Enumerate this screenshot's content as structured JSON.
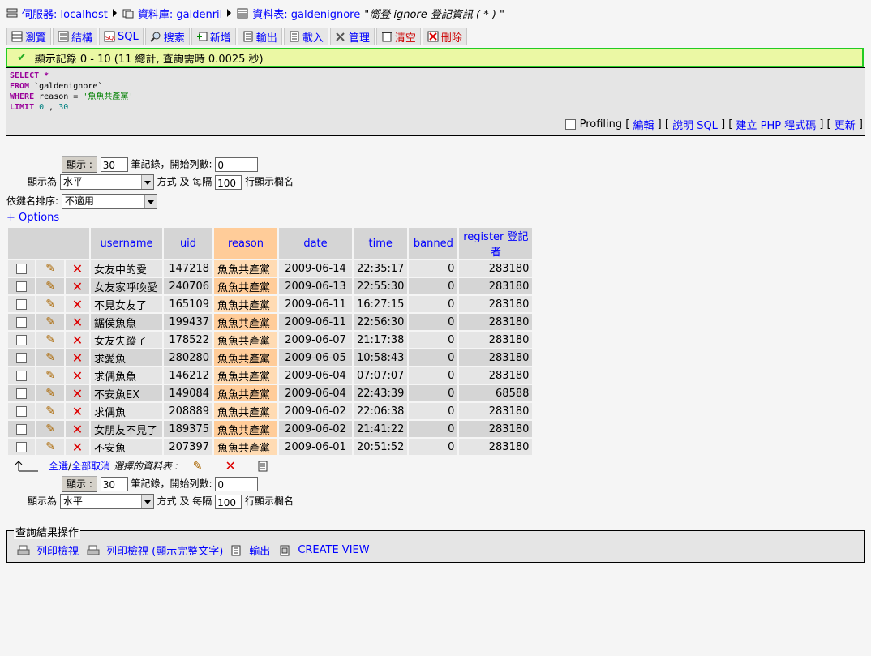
{
  "breadcrumb": {
    "server_label": "伺服器: localhost",
    "db_label": "資料庫: galdenril",
    "table_label": "資料表: galdenignore",
    "table_comment": "\"嚮登 ignore 登記資訊 ( * ) \""
  },
  "tabs": [
    {
      "label": "瀏覽"
    },
    {
      "label": "結構"
    },
    {
      "label": "SQL"
    },
    {
      "label": "搜索"
    },
    {
      "label": "新增"
    },
    {
      "label": "輸出"
    },
    {
      "label": "載入"
    },
    {
      "label": "管理"
    },
    {
      "label": "清空"
    },
    {
      "label": "刪除"
    }
  ],
  "status": {
    "message": "顯示記錄 0 - 10 (11 總計, 查詢需時 0.0025 秒)"
  },
  "sql": {
    "line1_kw": "SELECT",
    "line1_rest": " *",
    "line2_kw": "FROM",
    "line2_rest": " `galdenignore`",
    "line3_kw": "WHERE",
    "line3_mid": " reason = ",
    "line3_str": "'魚魚共產黨'",
    "line4_kw": "LIMIT",
    "line4_n1": " 0",
    "line4_comma": " , ",
    "line4_n2": "30"
  },
  "sql_footer": {
    "profiling": "Profiling",
    "edit": "編輯",
    "explain": "說明 SQL",
    "php": "建立 PHP 程式碼",
    "refresh": "更新"
  },
  "nav": {
    "show_button": "顯示 :",
    "rows_value": "30",
    "rows_suffix": "筆記錄，開始列數:",
    "start_value": "0",
    "mode_prefix": "顯示為",
    "mode_value": "水平",
    "mode_suffix": "方式 及 每隔",
    "repeat_value": "100",
    "repeat_suffix": "行顯示欄名",
    "sort_label": "依鍵名排序:",
    "sort_value": "不適用",
    "options": "+ Options"
  },
  "table": {
    "headers": [
      "username",
      "uid",
      "reason",
      "date",
      "time",
      "banned",
      "register 登記者"
    ],
    "rows": [
      [
        "女友中的愛",
        "147218",
        "魚魚共產黨",
        "2009-06-14",
        "22:35:17",
        "0",
        "283180"
      ],
      [
        "女友家呼喚愛",
        "240706",
        "魚魚共產黨",
        "2009-06-13",
        "22:55:30",
        "0",
        "283180"
      ],
      [
        "不見女友了",
        "165109",
        "魚魚共產黨",
        "2009-06-11",
        "16:27:15",
        "0",
        "283180"
      ],
      [
        "鋸侯魚魚",
        "199437",
        "魚魚共產黨",
        "2009-06-11",
        "22:56:30",
        "0",
        "283180"
      ],
      [
        "女友失蹤了",
        "178522",
        "魚魚共產黨",
        "2009-06-07",
        "21:17:38",
        "0",
        "283180"
      ],
      [
        "求愛魚",
        "280280",
        "魚魚共產黨",
        "2009-06-05",
        "10:58:43",
        "0",
        "283180"
      ],
      [
        "求偶魚魚",
        "146212",
        "魚魚共產黨",
        "2009-06-04",
        "07:07:07",
        "0",
        "283180"
      ],
      [
        "不安魚EX",
        "149084",
        "魚魚共產黨",
        "2009-06-04",
        "22:43:39",
        "0",
        "68588"
      ],
      [
        "求偶魚",
        "208889",
        "魚魚共產黨",
        "2009-06-02",
        "22:06:38",
        "0",
        "283180"
      ],
      [
        "女朋友不見了",
        "189375",
        "魚魚共產黨",
        "2009-06-02",
        "21:41:22",
        "0",
        "283180"
      ],
      [
        "不安魚",
        "207397",
        "魚魚共產黨",
        "2009-06-01",
        "20:51:52",
        "0",
        "283180"
      ]
    ]
  },
  "bulk": {
    "select_all": "全選",
    "slash": " / ",
    "unselect_all": "全部取消",
    "with_selected": "選擇的資料表 :"
  },
  "ops": {
    "legend": "查詢結果操作",
    "print": "列印檢視",
    "print_full": "列印檢視 (顯示完整文字)",
    "export": "輸出",
    "create_view": "CREATE VIEW"
  }
}
